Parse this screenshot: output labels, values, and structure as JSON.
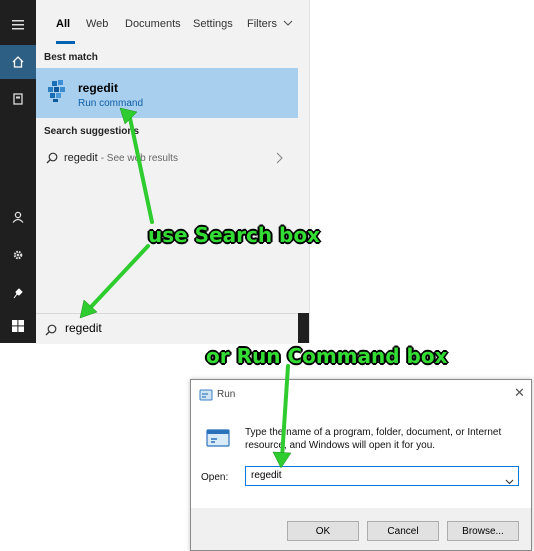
{
  "search_panel": {
    "tabs": [
      "All",
      "Web",
      "Documents",
      "Settings",
      "Filters"
    ],
    "best_match_label": "Best match",
    "best_match": {
      "title": "regedit",
      "subtitle": "Run command"
    },
    "suggestions_label": "Search suggestions",
    "suggestion": {
      "text": "regedit",
      "hint": "- See web results"
    },
    "query": "regedit"
  },
  "rail_icons": [
    "hamburger-icon",
    "home-icon",
    "notebook-icon",
    "person-icon",
    "gear-icon",
    "feedback-icon",
    "windows-start-icon"
  ],
  "annotations": {
    "top": "use Search box",
    "bottom": "or Run Command box",
    "color": "#33dd33"
  },
  "run_dialog": {
    "title": "Run",
    "description": "Type the name of a program, folder, document, or Internet resource, and Windows will open it for you.",
    "open_label": "Open:",
    "open_value": "regedit",
    "buttons": {
      "ok": "OK",
      "cancel": "Cancel",
      "browse": "Browse..."
    }
  }
}
